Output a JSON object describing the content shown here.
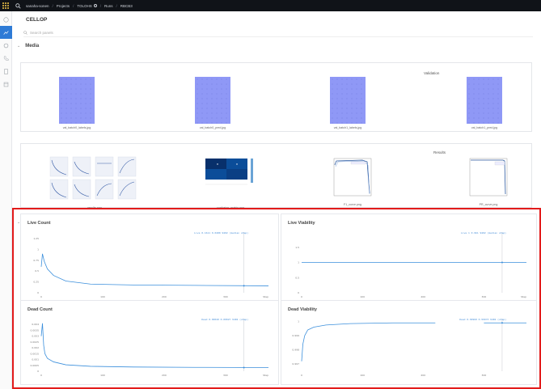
{
  "breadcrumb": [
    "sanaha-sonen",
    "Projects",
    "TOLOHS",
    "Runs",
    "RBCB3"
  ],
  "run_title": "CELLOP",
  "search": {
    "placeholder": "Search panels"
  },
  "sections": {
    "media": "Media",
    "validation": "Validation",
    "results": "Results"
  },
  "validation_media": [
    {
      "caption": "val_batch0_labels.jpg"
    },
    {
      "caption": "val_batch0_pred.jpg"
    },
    {
      "caption": "val_batch1_labels.jpg"
    },
    {
      "caption": "val_batch1_pred.jpg"
    }
  ],
  "results_media": [
    {
      "caption": "results.png"
    },
    {
      "caption": "confusion_matrix.png"
    },
    {
      "caption": "F1_curve.png"
    },
    {
      "caption": "PR_curve.png"
    }
  ],
  "colors": {
    "line": "#3b8fdc",
    "highlight": "#e21b1b",
    "active_nav": "#2e7bd6"
  },
  "icons": {
    "logo": "yellow-dot-grid-icon",
    "search": "search-icon",
    "nav": [
      "home-icon",
      "chart-icon",
      "circle-icon",
      "phone-icon",
      "document-icon",
      "table-icon"
    ]
  },
  "chart_data": [
    {
      "type": "line",
      "title": "Live Count",
      "xlim": [
        0,
        370
      ],
      "ylim": [
        0,
        1.4
      ],
      "x_ticks": [
        0,
        100,
        200,
        300
      ],
      "y_ticks": [
        "0",
        "0.25",
        "0.5",
        "0.75",
        "1",
        "1.25"
      ],
      "x_end_label": "Step",
      "x": [
        0,
        2,
        5,
        10,
        20,
        40,
        80,
        150,
        250,
        370
      ],
      "y": [
        0.6,
        0.9,
        0.72,
        0.55,
        0.4,
        0.27,
        0.2,
        0.18,
        0.17,
        0.16
      ],
      "legend": "Live  0.1611  0.0480  9402 (median step)"
    },
    {
      "type": "line",
      "title": "Live Viability",
      "xlim": [
        0,
        370
      ],
      "ylim": [
        0,
        2
      ],
      "x_ticks": [
        0,
        100,
        200,
        300
      ],
      "y_ticks": [
        "0",
        "0.5",
        "1",
        "1.5"
      ],
      "x_end_label": "Step",
      "x": [
        0,
        370
      ],
      "y": [
        1,
        1
      ],
      "legend": "Live  1  0.961  9402 (median step)"
    },
    {
      "type": "line",
      "title": "Dead Count",
      "xlim": [
        0,
        370
      ],
      "ylim": [
        0,
        0.0045
      ],
      "x_ticks": [
        0,
        100,
        200,
        300
      ],
      "y_ticks": [
        "0",
        "0.0005",
        "0.001",
        "0.0015",
        "0.002",
        "0.0025",
        "0.003",
        "0.0035",
        "0.004"
      ],
      "x_end_label": "Step",
      "x": [
        0,
        2,
        4,
        6,
        10,
        20,
        40,
        80,
        150,
        250,
        370
      ],
      "y": [
        0.003,
        0.0041,
        0.0022,
        0.0015,
        0.0011,
        0.0008,
        0.00055,
        0.00042,
        0.00036,
        0.00033,
        0.00031
      ],
      "legend": "Dead  0.00040  0.00027  9402 (step)"
    },
    {
      "type": "line",
      "title": "Dead Viability",
      "xlim": [
        0,
        370
      ],
      "ylim": [
        0.9965,
        1.0002
      ],
      "x_ticks": [
        0,
        100,
        200,
        300
      ],
      "y_ticks": [
        "0.997",
        "0.998",
        "0.999",
        "1"
      ],
      "x_end_label": "",
      "x": [
        0,
        2,
        5,
        10,
        20,
        40,
        80,
        150,
        220
      ],
      "y": [
        0.9972,
        0.9984,
        0.999,
        0.9994,
        0.9996,
        0.99975,
        0.99985,
        0.9999,
        0.9999
      ],
      "x2": [
        300,
        370
      ],
      "y2": [
        0.9999,
        0.9999
      ],
      "legend": "Dead  0.99960  0.99973  9402 (step)"
    }
  ]
}
